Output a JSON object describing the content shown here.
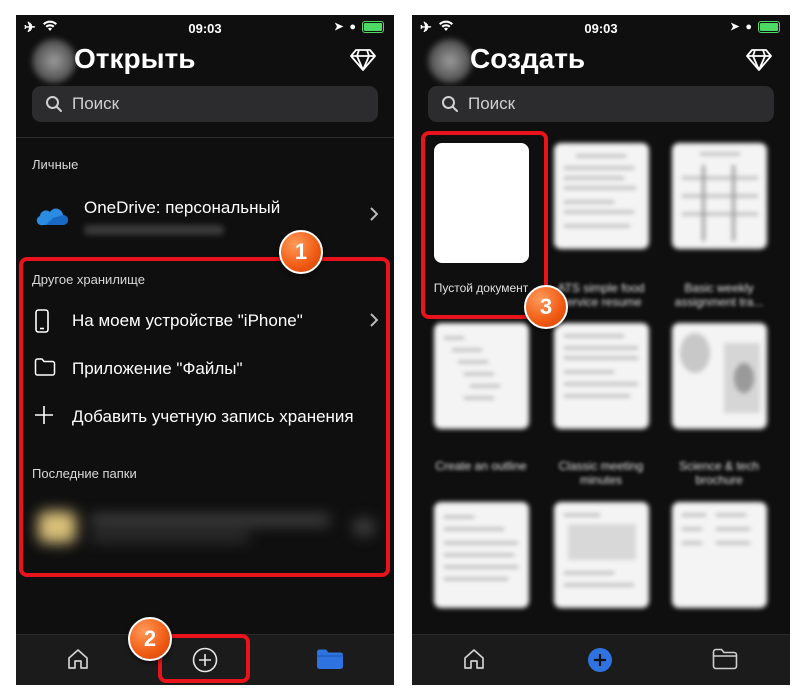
{
  "status": {
    "time": "09:03"
  },
  "left": {
    "title": "Открыть",
    "search_placeholder": "Поиск",
    "personal_label": "Личные",
    "onedrive_label": "OneDrive: персональный",
    "other_storage_label": "Другое хранилище",
    "storage_items": [
      {
        "label": "На моем устройстве \"iPhone\"",
        "icon": "phone-icon"
      },
      {
        "label": "Приложение \"Файлы\"",
        "icon": "folder-icon"
      },
      {
        "label": "Добавить учетную запись хранения",
        "icon": "plus-icon"
      }
    ],
    "recent_folders_label": "Последние папки",
    "tabs": [
      "home-icon",
      "create-plus-icon",
      "folder-filled-icon"
    ]
  },
  "right": {
    "title": "Создать",
    "search_placeholder": "Поиск",
    "templates": [
      {
        "caption": "Пустой документ"
      },
      {
        "caption": "ATS simple food service resume"
      },
      {
        "caption": "Basic weekly assignment tra..."
      },
      {
        "caption": "Create an outline"
      },
      {
        "caption": "Classic meeting minutes"
      },
      {
        "caption": "Science & tech brochure"
      },
      {
        "caption": ""
      },
      {
        "caption": ""
      },
      {
        "caption": ""
      }
    ],
    "tabs": [
      "home-icon",
      "create-plus-icon",
      "folder-icon"
    ]
  },
  "annotations": {
    "badge1": "1",
    "badge2": "2",
    "badge3": "3",
    "color": "#e8131b",
    "badge_color": "#f05a12"
  },
  "colors": {
    "background": "#0f0f0f",
    "accent_blue": "#2f73e0",
    "onedrive_blue": "#2a8be0"
  }
}
